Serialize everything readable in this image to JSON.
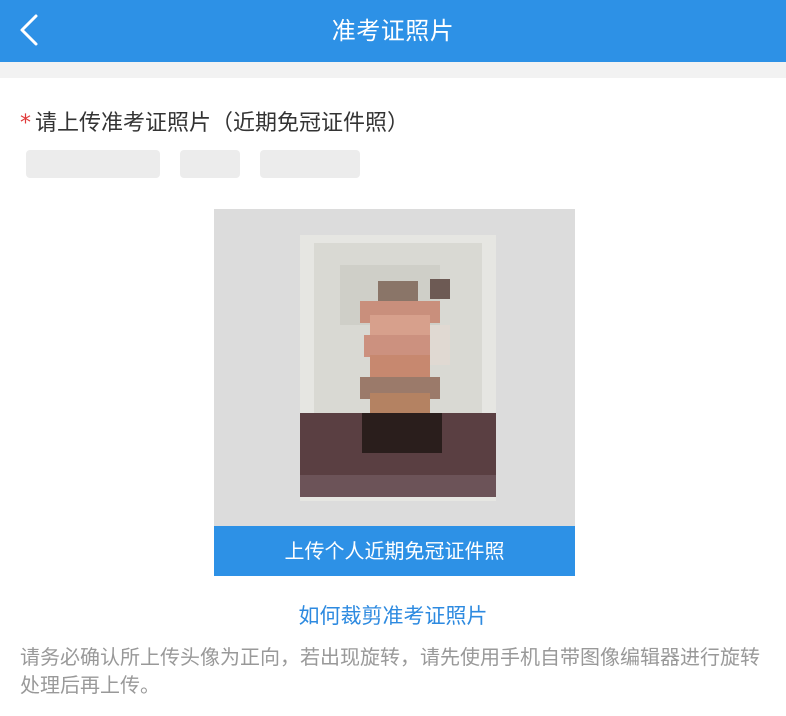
{
  "header": {
    "title": "准考证照片"
  },
  "upload": {
    "prompt": "请上传准考证照片（近期免冠证件照）",
    "required_mark": "*",
    "button_label": "上传个人近期免冠证件照"
  },
  "help": {
    "link_label": "如何裁剪准考证照片"
  },
  "notice": {
    "text": "请务必确认所上传头像为正向，若出现旋转，请先使用手机自带图像编辑器进行旋转处理后再上传。"
  },
  "colors": {
    "accent": "#2d91e6",
    "required": "#e03a3a",
    "link": "#2d8ae0",
    "muted": "#999999"
  },
  "icons": {
    "back": "chevron-left-icon"
  }
}
